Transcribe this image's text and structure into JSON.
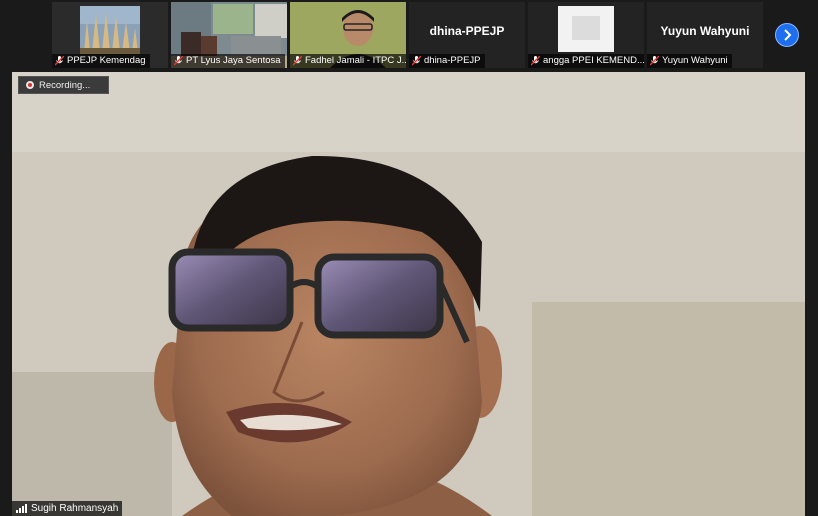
{
  "participants": [
    {
      "name": "PPEJP Kemendag",
      "muted": true,
      "video": true
    },
    {
      "name": "PT Lyus Jaya Sentosa",
      "muted": true,
      "video": true
    },
    {
      "name": "Fadhel Jamali - ITPC J...",
      "muted": true,
      "video": true
    },
    {
      "name": "dhina-PPEJP",
      "muted": true,
      "video": false,
      "display_name": "dhina-PPEJP"
    },
    {
      "name": "angga PPEI KEMEND...",
      "muted": true,
      "video": true
    },
    {
      "name": "Yuyun Wahyuni",
      "muted": true,
      "video": false,
      "display_name": "Yuyun Wahyuni"
    }
  ],
  "recording": {
    "label": "Recording..."
  },
  "active_speaker": {
    "name": "Sugih Rahmansyah"
  },
  "colors": {
    "accent": "#1e6ff0",
    "muted_mic": "#e53935"
  },
  "icons": {
    "next": "chevron-right-icon",
    "mic_muted": "mic-muted-icon",
    "signal": "signal-bars-icon",
    "recording": "record-dot-icon"
  }
}
